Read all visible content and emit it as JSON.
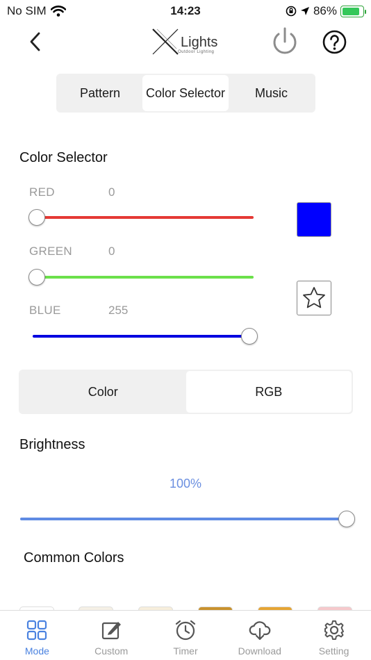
{
  "status": {
    "carrier": "No SIM",
    "time": "14:23",
    "battery": "86%",
    "battery_level": 0.86
  },
  "header": {
    "logo_text": "Lights",
    "logo_sub": "Outdoor Lighting"
  },
  "tabs": [
    {
      "label": "Pattern",
      "active": false
    },
    {
      "label": "Color Selector",
      "active": true
    },
    {
      "label": "Music",
      "active": false
    }
  ],
  "color_selector": {
    "title": "Color Selector",
    "red": {
      "label": "RED",
      "value": "0",
      "level": 0
    },
    "green": {
      "label": "GREEN",
      "value": "0",
      "level": 0
    },
    "blue": {
      "label": "BLUE",
      "value": "255",
      "level": 1
    },
    "swatch_color": "#0000ff"
  },
  "mode_toggle": {
    "color_label": "Color",
    "rgb_label": "RGB",
    "active": "RGB"
  },
  "brightness": {
    "title": "Brightness",
    "value": "100%",
    "level": 1.0
  },
  "common_colors": {
    "title": "Common Colors",
    "colors": [
      "#ffffff",
      "#f5f0e6",
      "#f7eedc",
      "#c9922e",
      "#e6a534",
      "#f6c9cc"
    ]
  },
  "tab_bar": [
    {
      "label": "Mode",
      "icon": "grid-icon",
      "active": true
    },
    {
      "label": "Custom",
      "icon": "edit-icon",
      "active": false
    },
    {
      "label": "Timer",
      "icon": "alarm-clock-icon",
      "active": false
    },
    {
      "label": "Download",
      "icon": "cloud-download-icon",
      "active": false
    },
    {
      "label": "Setting",
      "icon": "gear-icon",
      "active": false
    }
  ],
  "colors": {
    "accent": "#4a82e0",
    "red_track": "#e53935",
    "green_track": "#6be04a",
    "blue_track": "#0000e0",
    "brightness_track": "#5f8be3"
  }
}
